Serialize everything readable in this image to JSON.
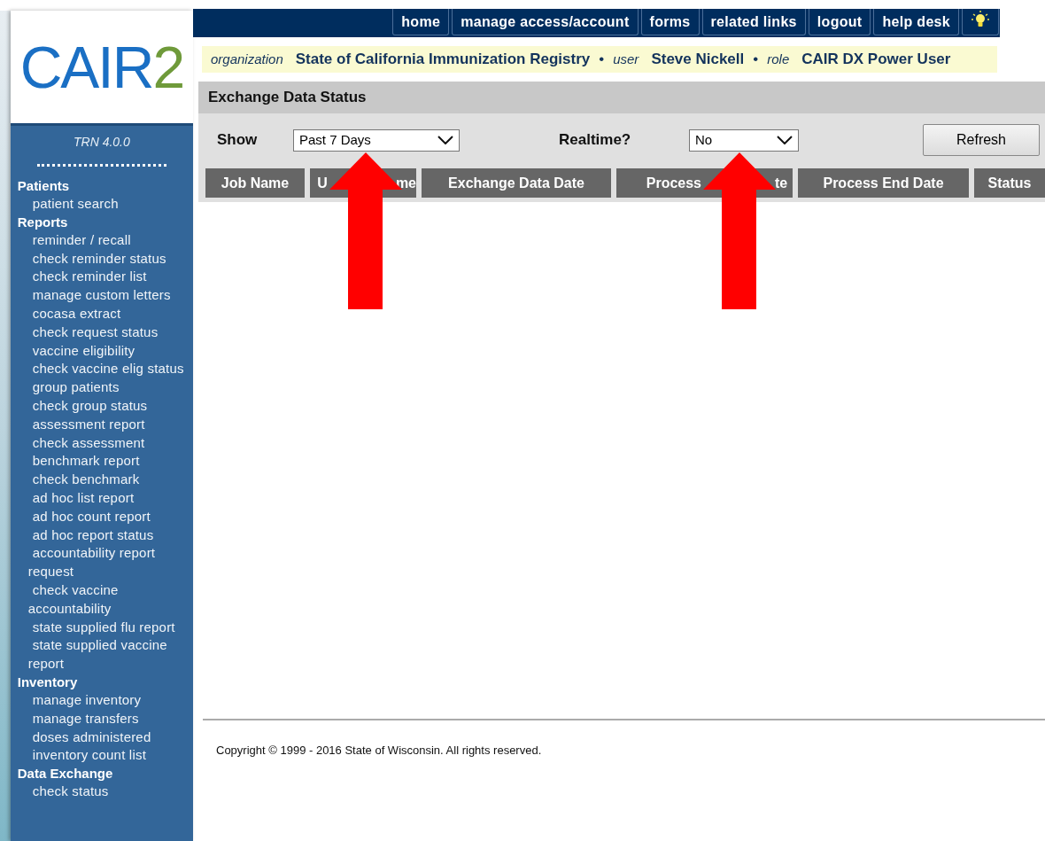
{
  "nav": {
    "tabs": [
      "home",
      "manage access/account",
      "forms",
      "related links",
      "logout",
      "help desk"
    ]
  },
  "logo": {
    "text": "CAIR",
    "accent": "2"
  },
  "info_bar": [
    {
      "label": "organization",
      "value": "State of California Immunization Registry",
      "separator": "•"
    },
    {
      "label": "user",
      "value": "Steve Nickell",
      "separator": "•"
    },
    {
      "label": "role",
      "value": "CAIR DX Power User"
    }
  ],
  "sidebar": {
    "version": "TRN 4.0.0",
    "sections": [
      {
        "title": "Patients",
        "items": [
          "patient search"
        ]
      },
      {
        "title": "Reports",
        "items": [
          "reminder / recall",
          "check reminder status",
          "check reminder list",
          "manage custom letters",
          "cocasa extract",
          "check request status",
          "vaccine eligibility",
          "check vaccine elig status",
          "group patients",
          "check group status",
          "assessment report",
          "check assessment",
          "benchmark report",
          "check benchmark",
          "ad hoc list report",
          "ad hoc count report",
          "ad hoc report status",
          "accountability report request",
          "check vaccine accountability",
          "state supplied flu report",
          "state supplied vaccine report"
        ]
      },
      {
        "title": "Inventory",
        "items": [
          "manage inventory",
          "manage transfers",
          "doses administered",
          "inventory count list"
        ]
      },
      {
        "title": "Data Exchange",
        "items": [
          "check status"
        ]
      }
    ]
  },
  "page_title": "Exchange Data Status",
  "filters": [
    {
      "label": "Show",
      "value": "Past 7 Days"
    },
    {
      "label": "Realtime?",
      "value": "No"
    }
  ],
  "refresh_button": "Refresh",
  "table": {
    "columns": [
      [
        "Job Name"
      ],
      [
        "U",
        "me"
      ],
      [
        "Exchange Data Date"
      ],
      [
        "Process",
        "te"
      ],
      [
        "Process End Date"
      ],
      [
        "Status"
      ]
    ]
  },
  "annotations": [
    {
      "kind": "arrow"
    },
    {
      "kind": "arrow"
    }
  ],
  "footer": "Copyright © 1999 - 2016 State of Wisconsin. All rights reserved."
}
